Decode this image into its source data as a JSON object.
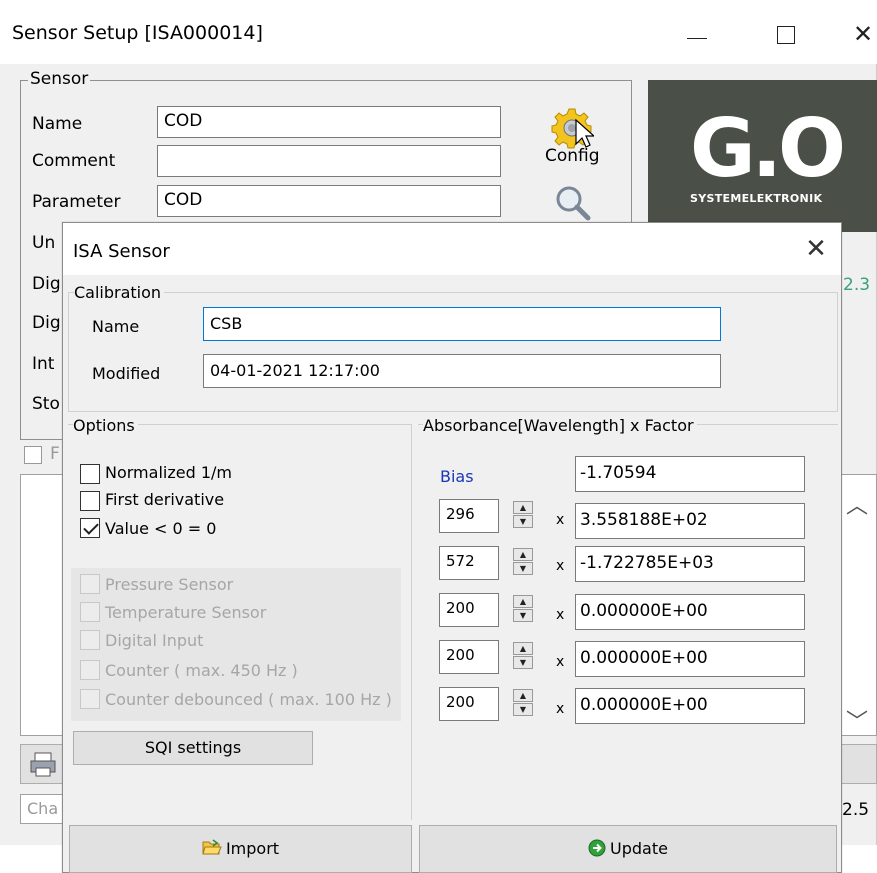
{
  "bg_window": {
    "title": "Sensor Setup [ISA000014]",
    "sensor_group_label": "Sensor",
    "fields": [
      {
        "label": "Name",
        "value": "COD"
      },
      {
        "label": "Comment",
        "value": ""
      },
      {
        "label": "Parameter",
        "value": "COD"
      },
      {
        "label": "Un",
        "value": ""
      },
      {
        "label": "Dig",
        "value": ""
      },
      {
        "label": "Dig",
        "value": ""
      },
      {
        "label": "Int",
        "value": ""
      },
      {
        "label": "Sto",
        "value": ""
      }
    ],
    "config_label": "Config",
    "logo_text": "G.O",
    "logo_subtext": "SYSTEMELEKTRONIK",
    "version_text_1": "2.3",
    "version_text_2": "2.5",
    "checkbox_label": "F",
    "status_text": "Cha"
  },
  "dialog": {
    "title": "ISA Sensor",
    "calibration": {
      "legend": "Calibration",
      "name_label": "Name",
      "name_value": "CSB",
      "modified_label": "Modified",
      "modified_value": "04-01-2021 12:17:00"
    },
    "options": {
      "legend": "Options",
      "items": [
        {
          "label": "Normalized 1/m",
          "checked": false
        },
        {
          "label": "First derivative",
          "checked": false
        },
        {
          "label": "Value < 0 = 0",
          "checked": true
        }
      ],
      "disabled_items": [
        {
          "label": "Pressure Sensor"
        },
        {
          "label": "Temperature Sensor"
        },
        {
          "label": "Digital Input"
        },
        {
          "label": "Counter ( max. 450 Hz )"
        },
        {
          "label": "Counter debounced ( max. 100 Hz )"
        }
      ],
      "sqi_button": "SQI settings"
    },
    "absorbance": {
      "legend": "Absorbance[Wavelength]  x Factor",
      "bias_label": "Bias",
      "bias_value": "-1.70594",
      "x_symbol": "x",
      "rows": [
        {
          "wavelength": "296",
          "factor": "3.558188E+02"
        },
        {
          "wavelength": "572",
          "factor": "-1.722785E+03"
        },
        {
          "wavelength": "200",
          "factor": "0.000000E+00"
        },
        {
          "wavelength": "200",
          "factor": "0.000000E+00"
        },
        {
          "wavelength": "200",
          "factor": "0.000000E+00"
        }
      ]
    },
    "import_button": "Import",
    "update_button": "Update"
  },
  "colors": {
    "logo_bg": "#4a5047",
    "logo_accent": "#c5d21a",
    "bias_blue": "#1a37b8",
    "focus_border": "#0078d7",
    "version_green": "#3aa07a"
  }
}
